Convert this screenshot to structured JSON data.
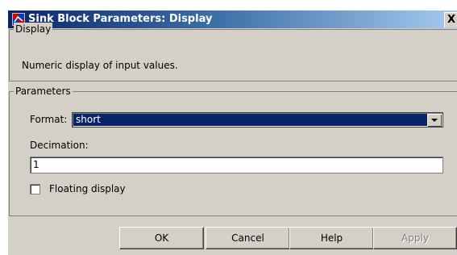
{
  "window": {
    "title": "Sink Block Parameters: Display",
    "close_label": "X",
    "icon": "simulink-block-icon"
  },
  "display_group": {
    "legend": "Display",
    "description": "Numeric display of input values."
  },
  "params_group": {
    "legend": "Parameters",
    "format_label": "Format:",
    "format_value": "short",
    "decimation_label": "Decimation:",
    "decimation_value": "1",
    "floating_label": "Floating display",
    "floating_checked": false
  },
  "buttons": {
    "ok": "OK",
    "cancel": "Cancel",
    "help": "Help",
    "apply": "Apply"
  },
  "colors": {
    "title_start": "#0a246a",
    "title_end": "#a6caf0",
    "dialog_bg": "#d4d0c8",
    "selection": "#0a246a"
  }
}
